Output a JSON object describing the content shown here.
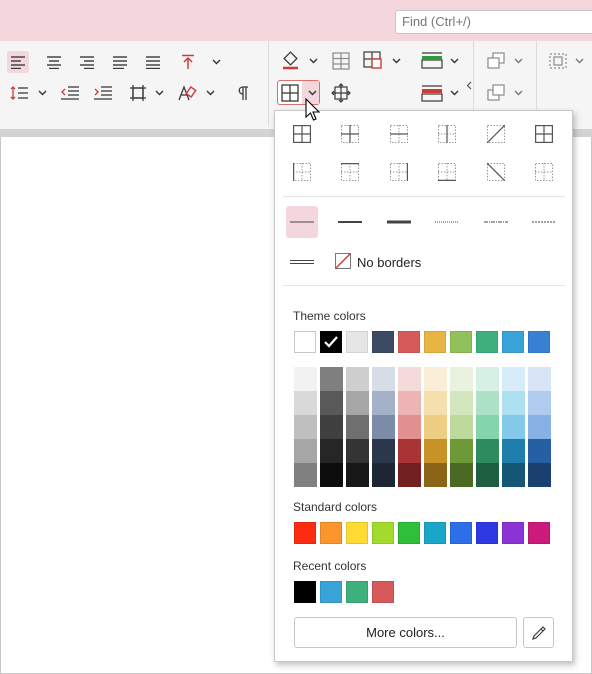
{
  "search": {
    "placeholder": "Find (Ctrl+/)"
  },
  "ribbon": {
    "paragraph_icons": [
      "align-left-icon",
      "align-center-icon",
      "align-right-icon",
      "justify-icon",
      "distribute-icon",
      "text-direction-up-icon",
      "line-spacing-icon",
      "decrease-indent-icon",
      "increase-indent-icon",
      "cell-margins-icon",
      "clear-format-icon",
      "paragraph-mark-icon"
    ],
    "table_icons": [
      "fill-bucket-icon",
      "table-grid-icon",
      "merge-cells-icon",
      "insert-row-icon",
      "delete-row-icon",
      "borders-icon",
      "move-table-icon",
      "collapse-icon",
      "arrange-icon",
      "group-icon"
    ]
  },
  "borders": {
    "row1": [
      "all-borders",
      "inside-borders",
      "inside-horizontal",
      "inside-vertical",
      "diagonal-down",
      "outside-grid"
    ],
    "row2": [
      "left-border",
      "top-border",
      "right-border",
      "bottom-border",
      "diagonal-up",
      "no-grid"
    ]
  },
  "line_styles": [
    "thin",
    "medium",
    "thick",
    "dotted",
    "dash-dot",
    "dashed",
    "double"
  ],
  "no_borders_label": "No borders",
  "theme_colors_label": "Theme colors",
  "theme_colors": [
    "#ffffff",
    "#000000",
    "#e6e6e6",
    "#3c4b63",
    "#d75a5a",
    "#e8b443",
    "#91c15a",
    "#3eb07d",
    "#38a3d8",
    "#3681d4"
  ],
  "theme_shades": [
    [
      "#f2f2f2",
      "#d9d9d9",
      "#bfbfbf",
      "#a6a6a6",
      "#808080"
    ],
    [
      "#7f7f7f",
      "#595959",
      "#404040",
      "#262626",
      "#0d0d0d"
    ],
    [
      "#cfcfcf",
      "#a6a6a6",
      "#6f6f6f",
      "#343434",
      "#171717"
    ],
    [
      "#d6dde6",
      "#a5b1c6",
      "#7c8ca8",
      "#2c374b",
      "#1e2533"
    ],
    [
      "#f5dada",
      "#ecb4b4",
      "#e28f8f",
      "#a83434",
      "#721f1f"
    ],
    [
      "#faefd6",
      "#f4dfad",
      "#efce84",
      "#c79226",
      "#8a6518"
    ],
    [
      "#e9f2de",
      "#d3e6bd",
      "#bdd99c",
      "#6d9a37",
      "#4a6a24"
    ],
    [
      "#d6f1e4",
      "#ade2c9",
      "#84d4ae",
      "#2e8b5f",
      "#1f5f41"
    ],
    [
      "#d6ecf8",
      "#ade0f1",
      "#84c8ea",
      "#207ead",
      "#155676"
    ],
    [
      "#d7e5f6",
      "#afcbee",
      "#87b1e5",
      "#275fa3",
      "#1a406f"
    ]
  ],
  "standard_colors_label": "Standard colors",
  "standard_colors": [
    "#fc2c12",
    "#fc952b",
    "#fddb33",
    "#a2db2c",
    "#2ec03a",
    "#1aa6c9",
    "#2c6fe9",
    "#2d3ae3",
    "#8c33d6",
    "#cc1a7a"
  ],
  "recent_colors_label": "Recent colors",
  "recent_colors": [
    "#000000",
    "#38a3d8",
    "#3eb07d",
    "#d75a5a"
  ],
  "more_colors_label": "More colors..."
}
